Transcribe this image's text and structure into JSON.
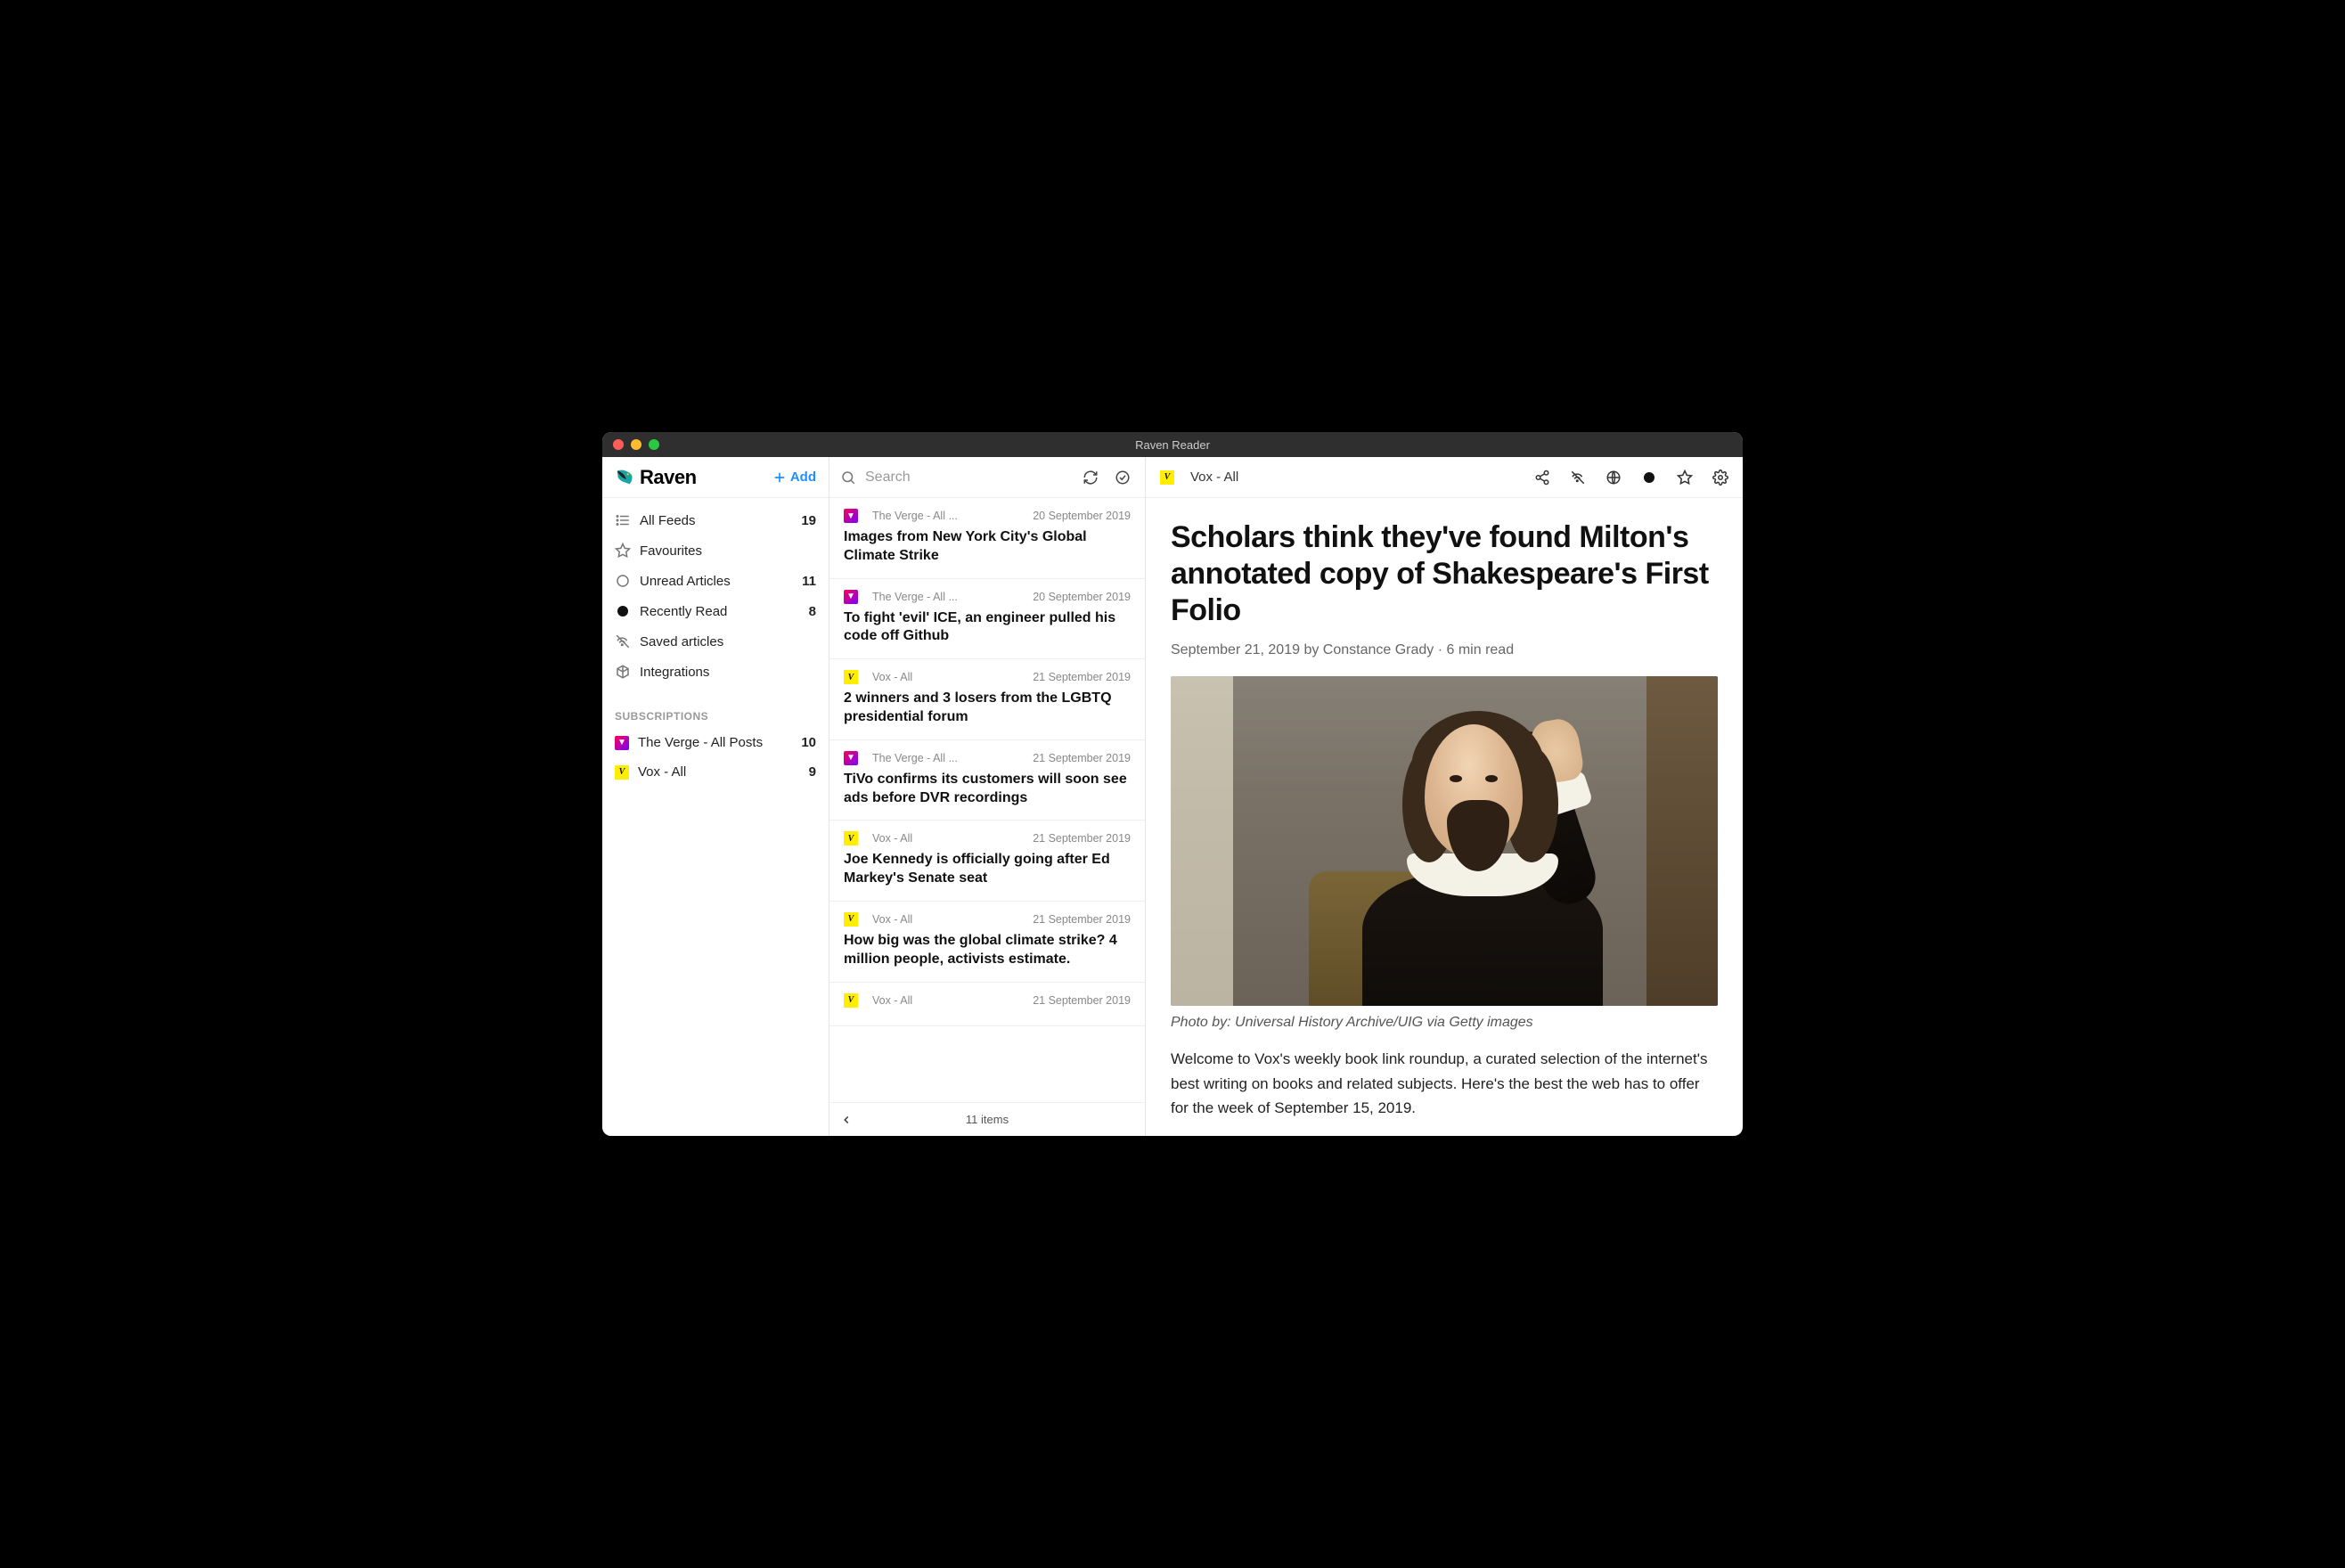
{
  "window": {
    "title": "Raven Reader"
  },
  "sidebar": {
    "logo_text": "Raven",
    "add_label": "Add",
    "nav": [
      {
        "label": "All Feeds",
        "count": "19",
        "icon": "list"
      },
      {
        "label": "Favourites",
        "count": "",
        "icon": "star"
      },
      {
        "label": "Unread Articles",
        "count": "11",
        "icon": "circle-outline"
      },
      {
        "label": "Recently Read",
        "count": "8",
        "icon": "circle-filled"
      },
      {
        "label": "Saved articles",
        "count": "",
        "icon": "offline"
      },
      {
        "label": "Integrations",
        "count": "",
        "icon": "box"
      }
    ],
    "subscriptions_header": "SUBSCRIPTIONS",
    "subscriptions": [
      {
        "label": "The Verge - All Posts",
        "count": "10",
        "icon": "verge"
      },
      {
        "label": "Vox - All",
        "count": "9",
        "icon": "vox"
      }
    ]
  },
  "list": {
    "search_placeholder": "Search",
    "items": [
      {
        "source": "The Verge - All ...",
        "icon": "verge",
        "date": "20 September 2019",
        "title": "Images from New York City's Global Climate Strike"
      },
      {
        "source": "The Verge - All ...",
        "icon": "verge",
        "date": "20 September 2019",
        "title": "To fight 'evil' ICE, an engineer pulled his code off Github"
      },
      {
        "source": "Vox - All",
        "icon": "vox",
        "date": "21 September 2019",
        "title": "2 winners and 3 losers from the LGBTQ presidential forum"
      },
      {
        "source": "The Verge - All ...",
        "icon": "verge",
        "date": "21 September 2019",
        "title": "TiVo confirms its customers will soon see ads before DVR recordings"
      },
      {
        "source": "Vox - All",
        "icon": "vox",
        "date": "21 September 2019",
        "title": "Joe Kennedy is officially going after Ed Markey's Senate seat"
      },
      {
        "source": "Vox - All",
        "icon": "vox",
        "date": "21 September 2019",
        "title": "How big was the global climate strike? 4 million people, activists estimate."
      },
      {
        "source": "Vox - All",
        "icon": "vox",
        "date": "21 September 2019",
        "title": ""
      }
    ],
    "footer_count": "11 items"
  },
  "reader": {
    "source": "Vox - All",
    "source_icon": "vox",
    "title": "Scholars think they've found Milton's annotated copy of Shakespeare's First Folio",
    "byline": "September 21, 2019 by Constance Grady · 6 min read",
    "caption": "Photo by: Universal History Archive/UIG via Getty images",
    "paragraph": "Welcome to Vox's weekly book link roundup, a curated selection of the internet's best writing on books and related subjects. Here's the best the web has to offer for the week of September 15, 2019."
  }
}
